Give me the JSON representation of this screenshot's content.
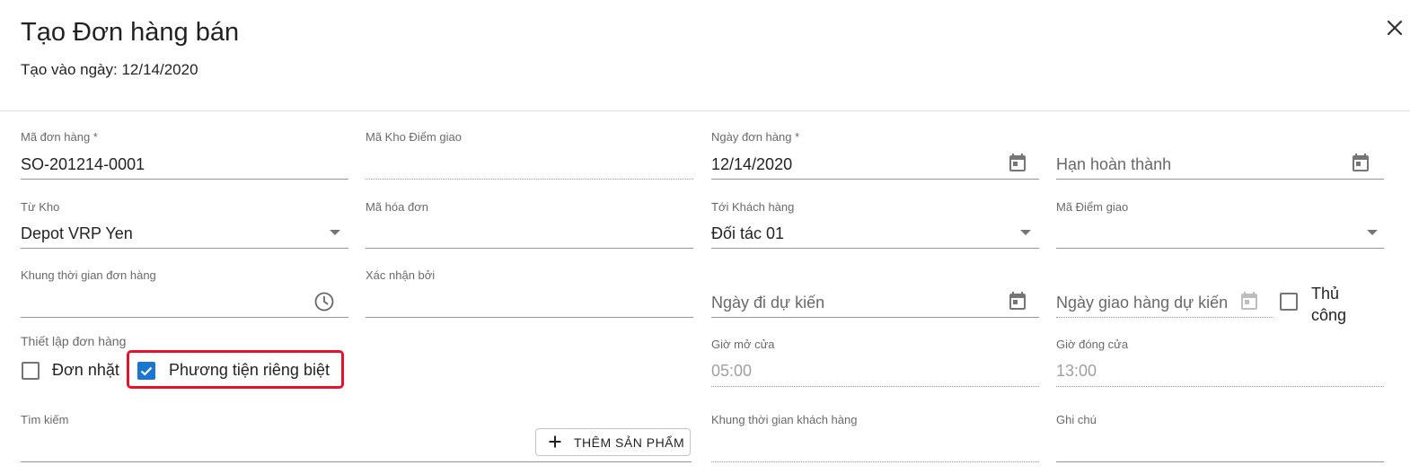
{
  "header": {
    "title": "Tạo Đơn hàng bán",
    "created_label": "Tạo vào ngày: 12/14/2020"
  },
  "fields": {
    "order_code": {
      "label": "Mã đơn hàng *",
      "value": "SO-201214-0001"
    },
    "delivery_warehouse_code": {
      "label": "Mã Kho Điểm giao",
      "value": ""
    },
    "order_date": {
      "label": "Ngày đơn hàng *",
      "value": "12/14/2020"
    },
    "deadline": {
      "placeholder": "Hạn hoàn thành"
    },
    "from_warehouse": {
      "label": "Từ Kho",
      "value": "Depot VRP Yen"
    },
    "invoice_code": {
      "label": "Mã hóa đơn",
      "value": ""
    },
    "to_customer": {
      "label": "Tới Khách hàng",
      "value": "Đối tác 01"
    },
    "delivery_point_code": {
      "label": "Mã Điểm giao",
      "value": ""
    },
    "order_time_window": {
      "label": "Khung thời gian đơn hàng",
      "value": ""
    },
    "confirmed_by": {
      "label": "Xác nhận bởi",
      "value": ""
    },
    "expected_departure": {
      "placeholder": "Ngày đi dự kiến"
    },
    "expected_delivery": {
      "placeholder": "Ngày giao hàng dự kiến"
    },
    "manual": {
      "label": "Thủ công",
      "checked": false
    },
    "open_time": {
      "label": "Giờ mở cửa",
      "value": "05:00"
    },
    "close_time": {
      "label": "Giờ đóng cửa",
      "value": "13:00"
    },
    "search": {
      "label": "Tìm kiếm",
      "value": ""
    },
    "customer_time_window": {
      "label": "Khung thời gian khách hàng",
      "value": ""
    },
    "note": {
      "label": "Ghi chú",
      "value": ""
    }
  },
  "order_setup": {
    "label": "Thiết lập đơn hàng",
    "single_order": {
      "label": "Đơn nhặt",
      "checked": false
    },
    "separate_vehicle": {
      "label": "Phương tiện riêng biệt",
      "checked": true
    }
  },
  "add_product_button": {
    "label": "THÊM SẢN PHẨM"
  },
  "colors": {
    "accent": "#1976d2",
    "highlight": "#e8112d"
  },
  "icons": [
    "close-icon",
    "calendar-icon",
    "clock-icon",
    "dropdown-arrow-icon",
    "plus-icon",
    "checkbox-icon"
  ]
}
